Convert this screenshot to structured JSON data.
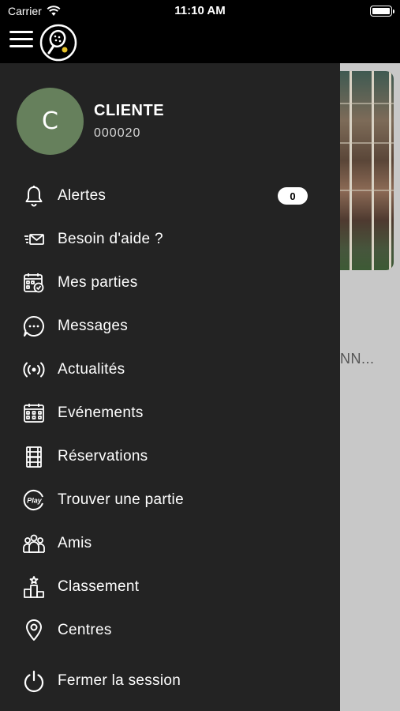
{
  "status_bar": {
    "carrier": "Carrier",
    "time": "11:10 AM"
  },
  "header": {
    "menu_icon": "hamburger-icon",
    "logo_icon": "padel-racket-logo"
  },
  "profile": {
    "initial": "C",
    "name": "CLIENTE",
    "id": "000020",
    "avatar_color": "#66805c"
  },
  "menu": {
    "alerts": {
      "label": "Alertes",
      "badge": "0",
      "icon": "bell-icon"
    },
    "help": {
      "label": "Besoin d'aide ?",
      "icon": "mail-fast-icon"
    },
    "my_games": {
      "label": "Mes parties",
      "icon": "calendar-check-icon"
    },
    "messages": {
      "label": "Messages",
      "icon": "chat-bubble-icon"
    },
    "news": {
      "label": "Actualités",
      "icon": "broadcast-icon"
    },
    "events": {
      "label": "Evénements",
      "icon": "calendar-grid-icon"
    },
    "bookings": {
      "label": "Réservations",
      "icon": "court-icon"
    },
    "find_game": {
      "label": "Trouver une partie",
      "icon": "play-icon"
    },
    "friends": {
      "label": "Amis",
      "icon": "group-icon"
    },
    "ranking": {
      "label": "Classement",
      "icon": "podium-icon"
    },
    "centers": {
      "label": "Centres",
      "icon": "map-pin-icon"
    },
    "logout": {
      "label": "Fermer la session",
      "icon": "power-icon"
    }
  },
  "background": {
    "truncated_text": "NN..."
  },
  "colors": {
    "drawer_bg": "#232323",
    "header_bg": "#000000",
    "accent": "#e6c229"
  }
}
